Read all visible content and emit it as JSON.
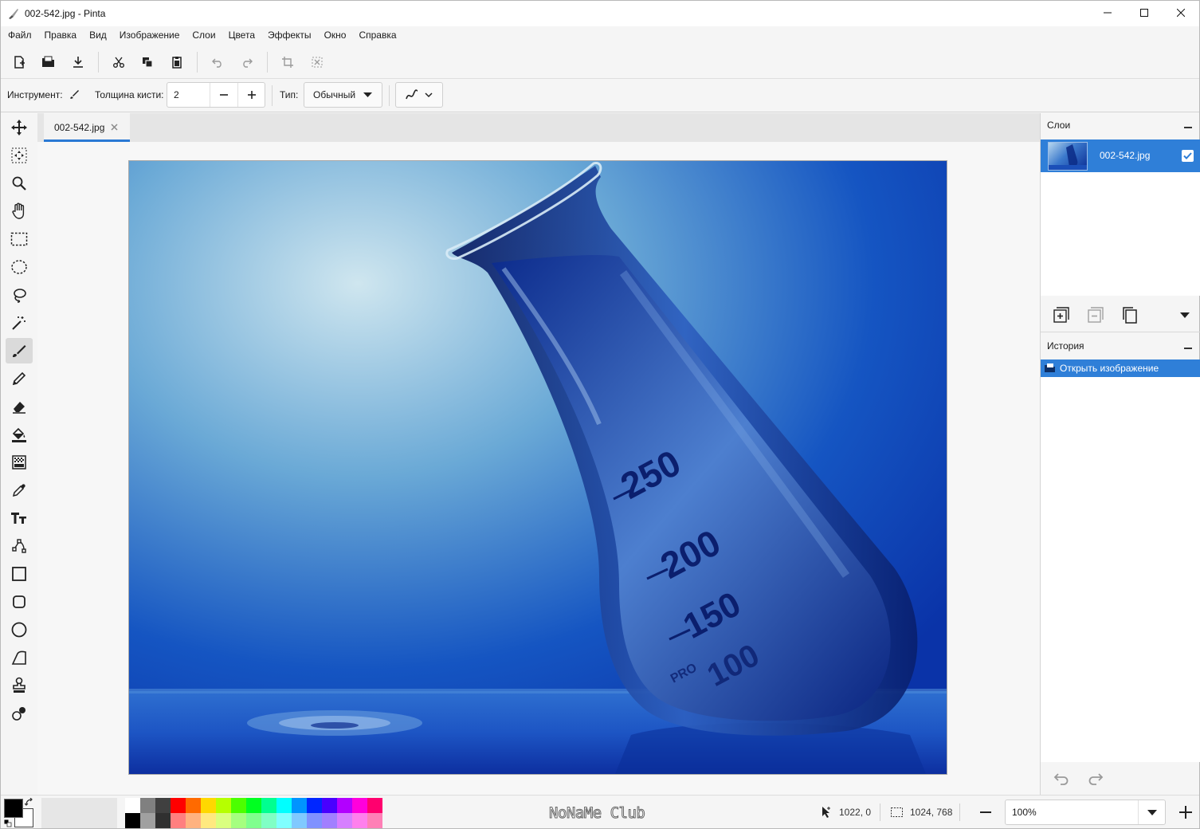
{
  "window": {
    "title": "002-542.jpg - Pinta"
  },
  "menu": [
    "Файл",
    "Правка",
    "Вид",
    "Изображение",
    "Слои",
    "Цвета",
    "Эффекты",
    "Окно",
    "Справка"
  ],
  "options": {
    "tool_label": "Инструмент:",
    "brush_width_label": "Толщина кисти:",
    "brush_width_value": "2",
    "type_label": "Тип:",
    "type_value": "Обычный"
  },
  "document": {
    "tab_name": "002-542.jpg"
  },
  "image_text": {
    "mark_250": "250",
    "mark_200": "200",
    "mark_150": "150",
    "mark_100": "100",
    "brand": "PRO"
  },
  "layers_panel": {
    "title": "Слои",
    "layers": [
      {
        "name": "002-542.jpg",
        "visible": true
      }
    ]
  },
  "history_panel": {
    "title": "История",
    "items": [
      "Открыть изображение"
    ]
  },
  "status": {
    "cursor_position": "1022, 0",
    "selection_size": "1024, 768",
    "zoom": "100%",
    "watermark": "NoNaMe Club"
  },
  "palette": {
    "primary": "#000000",
    "secondary": "#ffffff",
    "top_row": [
      "#ffffff",
      "#808080",
      "#404040",
      "#ff0000",
      "#ff6a00",
      "#ffd800",
      "#b6ff00",
      "#4cff00",
      "#00ff21",
      "#00ff90",
      "#00ffff",
      "#0094ff",
      "#0026ff",
      "#4800ff",
      "#b200ff",
      "#ff00dc",
      "#ff006e"
    ],
    "bottom_row": [
      "#000000",
      "#a0a0a0",
      "#303030",
      "#ff7f7f",
      "#ffb27f",
      "#ffe97f",
      "#daff7f",
      "#a5ff7f",
      "#7fff8e",
      "#7fffc5",
      "#7fffff",
      "#7fc9ff",
      "#7f92ff",
      "#a17fff",
      "#d67fff",
      "#ff7fed",
      "#ff7fb6"
    ]
  },
  "accent": "#2f7fd8"
}
